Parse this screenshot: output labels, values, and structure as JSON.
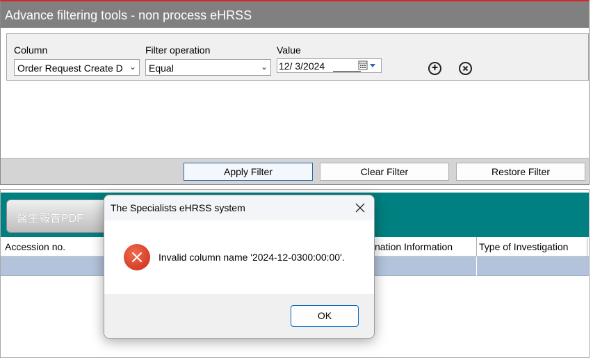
{
  "filter_window": {
    "title": "Advance filtering tools - non process eHRSS",
    "column_label": "Column",
    "column_value": "Order Request Create D",
    "operation_label": "Filter operation",
    "operation_value": "Equal",
    "value_label": "Value",
    "date_value": "12/  3/2024",
    "add_icon": "plus-circle-icon",
    "remove_icon": "x-circle-icon",
    "apply_label": "Apply Filter",
    "clear_label": "Clear Filter",
    "restore_label": "Restore Filter",
    "title_accent": "#d9262c"
  },
  "main_window": {
    "report_button_label": "醫生報告PDF",
    "columns": [
      "Accession no.",
      "Examination Information",
      "Type of Investigation"
    ],
    "visible_header_fragment": "nation Information",
    "toolbar_color": "#008080",
    "selected_row_color": "#b3c3dc"
  },
  "dialog": {
    "title": "The Specialists eHRSS system",
    "close_icon": "close-icon",
    "error_icon": "error-circle-icon",
    "message": "Invalid column name '2024-12-0300:00:00'.",
    "ok_label": "OK"
  }
}
